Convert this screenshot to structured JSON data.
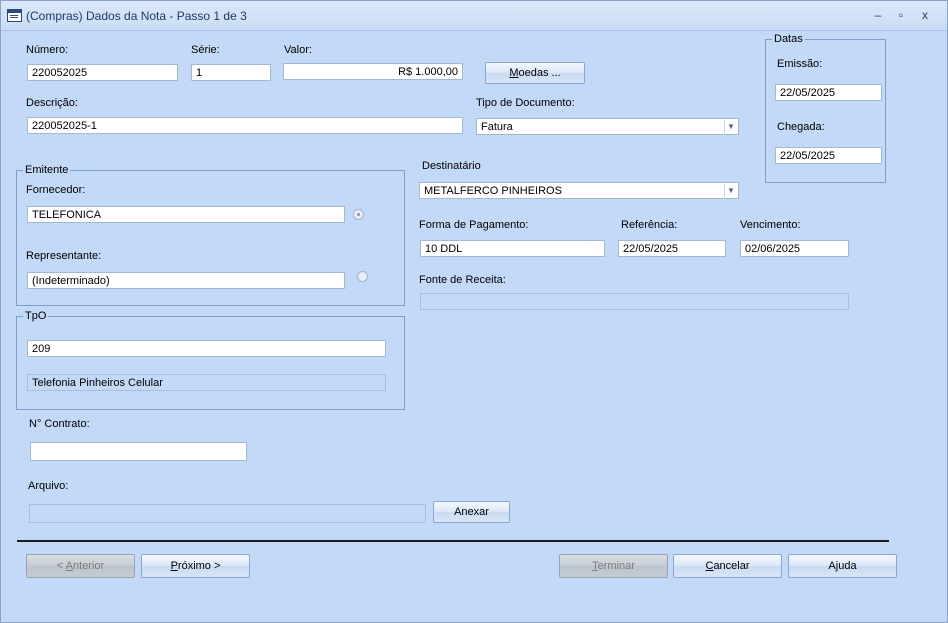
{
  "window": {
    "title": "(Compras) Dados da Nota - Passo 1 de 3",
    "minimize": "–",
    "maximize": "▫",
    "close": "x"
  },
  "form": {
    "numero": {
      "label": "Número:",
      "value": "220052025"
    },
    "serie": {
      "label": "Série:",
      "value": "1"
    },
    "valor": {
      "label": "Valor:",
      "value": "R$ 1.000,00"
    },
    "moedas_button": {
      "mnemonic": "M",
      "rest": "oedas ..."
    },
    "descricao": {
      "label": "Descrição:",
      "value": "220052025-1"
    },
    "tipo_documento": {
      "label": "Tipo de Documento:",
      "value": "Fatura"
    },
    "datas": {
      "title": "Datas",
      "emissao": {
        "label": "Emissão:",
        "value": "22/05/2025"
      },
      "chegada": {
        "label": "Chegada:",
        "value": "22/05/2025"
      }
    },
    "emitente": {
      "title": "Emitente",
      "fornecedor": {
        "label": "Fornecedor:",
        "value": "TELEFONICA"
      },
      "representante": {
        "label": "Representante:",
        "value": "(Indeterminado)"
      }
    },
    "destinatario": {
      "label": "Destinatário",
      "value": "METALFERCO PINHEIROS"
    },
    "forma_pagamento": {
      "label": "Forma de Pagamento:",
      "value": "10 DDL"
    },
    "referencia": {
      "label": "Referência:",
      "value": "22/05/2025"
    },
    "vencimento": {
      "label": "Vencimento:",
      "value": "02/06/2025"
    },
    "fonte_receita": {
      "label": "Fonte de Receita:",
      "value": ""
    },
    "tpo": {
      "title": "TpO",
      "code": "209",
      "description": "Telefonia Pinheiros Celular"
    },
    "contrato": {
      "label": "N° Contrato:",
      "value": ""
    },
    "arquivo": {
      "label": "Arquivo:",
      "value": ""
    },
    "anexar_button": "Anexar"
  },
  "footer": {
    "anterior": {
      "prefix": "< ",
      "mnemonic": "A",
      "rest": "nterior"
    },
    "proximo": {
      "mnemonic": "P",
      "rest": "róximo >"
    },
    "terminar": {
      "mnemonic": "T",
      "rest": "erminar"
    },
    "cancelar": {
      "mnemonic": "C",
      "rest": "ancelar"
    },
    "ajuda": "Ajuda"
  }
}
